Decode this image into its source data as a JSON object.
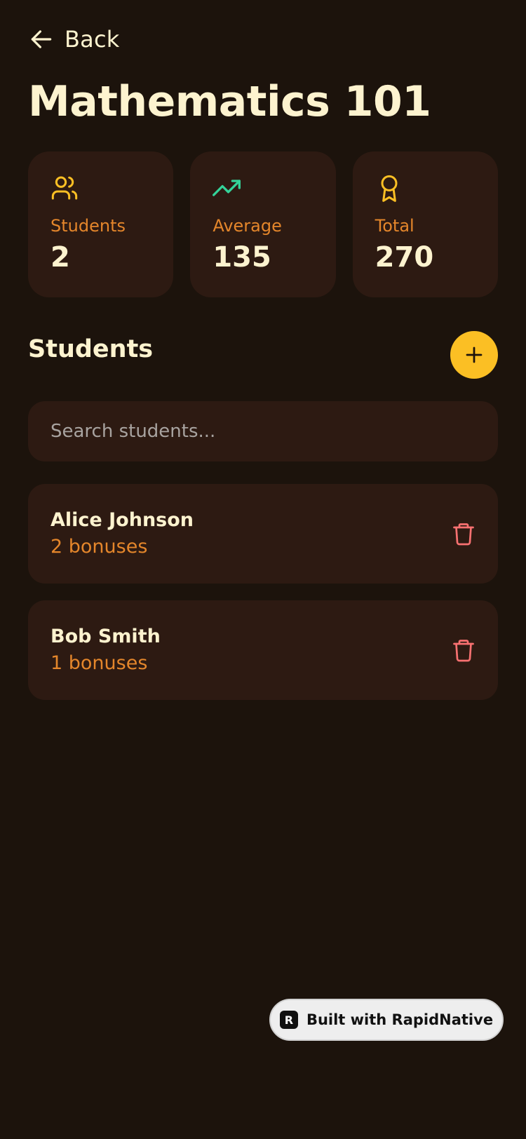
{
  "header": {
    "back_label": "Back",
    "title": "Mathematics 101"
  },
  "stats": [
    {
      "icon": "users-icon",
      "label": "Students",
      "value": "2",
      "icon_color": "#fbbf24"
    },
    {
      "icon": "trending-up-icon",
      "label": "Average",
      "value": "135",
      "icon_color": "#34d399"
    },
    {
      "icon": "award-icon",
      "label": "Total",
      "value": "270",
      "icon_color": "#fbbf24"
    }
  ],
  "students_section": {
    "title": "Students",
    "add_icon": "plus-icon",
    "search_placeholder": "Search students..."
  },
  "students": [
    {
      "name": "Alice Johnson",
      "bonuses": "2 bonuses"
    },
    {
      "name": "Bob Smith",
      "bonuses": "1 bonuses"
    }
  ],
  "badge": {
    "logo_glyph": "R",
    "label": "Built with RapidNative"
  },
  "colors": {
    "background": "#1c130c",
    "card": "#2d1a12",
    "text_primary": "#fdf3cf",
    "accent_orange": "#e4862b",
    "accent_yellow": "#fbbf24",
    "accent_green": "#34d399",
    "danger": "#f87171"
  }
}
